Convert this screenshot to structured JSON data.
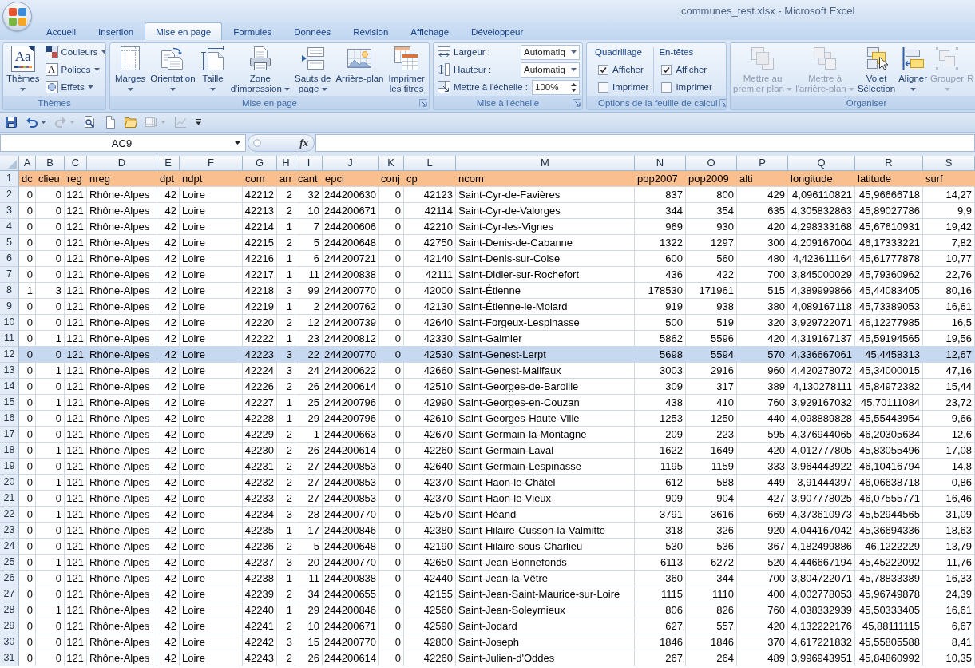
{
  "window": {
    "title": "communes_test.xlsx - Microsoft Excel"
  },
  "tabs": [
    {
      "label": "Accueil",
      "selected": false
    },
    {
      "label": "Insertion",
      "selected": false
    },
    {
      "label": "Mise en page",
      "selected": true
    },
    {
      "label": "Formules",
      "selected": false
    },
    {
      "label": "Données",
      "selected": false
    },
    {
      "label": "Révision",
      "selected": false
    },
    {
      "label": "Affichage",
      "selected": false
    },
    {
      "label": "Développeur",
      "selected": false
    }
  ],
  "ribbon": {
    "groups": [
      {
        "kind": "themes",
        "label": "Thèmes",
        "launcher": false,
        "button": {
          "label": "Thèmes",
          "glyph": "Aa",
          "menu": true
        },
        "items": [
          {
            "kind": "colors",
            "label": "Couleurs",
            "menu": true
          },
          {
            "kind": "fonts",
            "label": "Polices",
            "glyph": "A",
            "menu": true
          },
          {
            "kind": "effects",
            "label": "Effets",
            "menu": true
          }
        ]
      },
      {
        "kind": "large",
        "label": "Mise en page",
        "launcher": true,
        "buttons": [
          {
            "kind": "margins",
            "lines": [
              "Marges"
            ],
            "menu": true
          },
          {
            "kind": "orientation",
            "lines": [
              "Orientation"
            ],
            "menu": true
          },
          {
            "kind": "size",
            "lines": [
              "Taille"
            ],
            "menu": true
          },
          {
            "kind": "print_area",
            "lines": [
              "Zone",
              "d'impression"
            ],
            "menu": true
          },
          {
            "kind": "breaks",
            "lines": [
              "Sauts de",
              "page"
            ],
            "menu": true
          },
          {
            "kind": "background",
            "lines": [
              "Arrière-plan"
            ],
            "menu": false
          },
          {
            "kind": "print_titles",
            "lines": [
              "Imprimer",
              "les titres"
            ],
            "menu": false
          }
        ]
      },
      {
        "kind": "scale",
        "label": "Mise à l'échelle",
        "launcher": true,
        "fields": [
          {
            "kind": "width",
            "label": "Largeur :",
            "value": "Automatiq"
          },
          {
            "kind": "height",
            "label": "Hauteur :",
            "value": "Automatiq"
          },
          {
            "kind": "scale",
            "label": "Mettre à l'échelle :",
            "value": "100%"
          }
        ]
      },
      {
        "kind": "options",
        "label": "Options de la feuille de calcul",
        "launcher": true,
        "columns": [
          {
            "title": "Quadrillage",
            "options": [
              {
                "label": "Afficher",
                "checked": true
              },
              {
                "label": "Imprimer",
                "checked": false
              }
            ]
          },
          {
            "title": "En-têtes",
            "options": [
              {
                "label": "Afficher",
                "checked": true
              },
              {
                "label": "Imprimer",
                "checked": false
              }
            ]
          }
        ]
      },
      {
        "kind": "large",
        "label": "Organiser",
        "launcher": false,
        "buttons": [
          {
            "kind": "bring_forward",
            "lines": [
              "Mettre au",
              "premier plan"
            ],
            "menu": true,
            "disabled": true
          },
          {
            "kind": "send_backward",
            "lines": [
              "Mettre à",
              "l'arrière-plan"
            ],
            "menu": true,
            "disabled": true
          },
          {
            "kind": "selection_pane",
            "lines": [
              "Volet",
              "Sélection"
            ],
            "menu": false,
            "disabled": false
          },
          {
            "kind": "align",
            "lines": [
              "Aligner"
            ],
            "menu": true,
            "disabled": false
          },
          {
            "kind": "group",
            "lines": [
              "Grouper"
            ],
            "menu": true,
            "disabled": true
          },
          {
            "kind": "rotate",
            "lines": [
              "R"
            ],
            "menu": false,
            "disabled": true
          }
        ]
      }
    ]
  },
  "quick_access": [
    {
      "kind": "save",
      "menu": false,
      "disabled": false
    },
    {
      "kind": "undo",
      "menu": true,
      "disabled": false
    },
    {
      "kind": "redo",
      "menu": true,
      "disabled": true
    },
    {
      "kind": "print_preview",
      "menu": false,
      "disabled": false
    },
    {
      "kind": "new",
      "menu": false,
      "disabled": false
    },
    {
      "kind": "open",
      "menu": false,
      "disabled": false
    },
    {
      "kind": "sort",
      "menu": true,
      "disabled": true
    },
    {
      "kind": "chart",
      "menu": false,
      "disabled": true
    },
    {
      "kind": "customize",
      "menu": false,
      "disabled": false
    }
  ],
  "formula_bar": {
    "name_box": "AC9",
    "function_button": "fx"
  },
  "sheet": {
    "columns": [
      {
        "letter": "A",
        "kind": "number"
      },
      {
        "letter": "B",
        "kind": "number"
      },
      {
        "letter": "C",
        "kind": "number"
      },
      {
        "letter": "D",
        "kind": "text"
      },
      {
        "letter": "E",
        "kind": "number"
      },
      {
        "letter": "F",
        "kind": "text"
      },
      {
        "letter": "G",
        "kind": "number"
      },
      {
        "letter": "H",
        "kind": "number"
      },
      {
        "letter": "I",
        "kind": "number"
      },
      {
        "letter": "J",
        "kind": "number"
      },
      {
        "letter": "K",
        "kind": "number"
      },
      {
        "letter": "L",
        "kind": "number"
      },
      {
        "letter": "M",
        "kind": "text"
      },
      {
        "letter": "N",
        "kind": "number"
      },
      {
        "letter": "O",
        "kind": "number"
      },
      {
        "letter": "P",
        "kind": "number"
      },
      {
        "letter": "Q",
        "kind": "number"
      },
      {
        "letter": "R",
        "kind": "number"
      },
      {
        "letter": "S",
        "kind": "number"
      }
    ],
    "rows": [
      {
        "number": "1",
        "kind": "header",
        "selected": false,
        "cells": [
          "dc",
          "clieu",
          "reg",
          "nreg",
          "dpt",
          "ndpt",
          "com",
          "arr",
          "cant",
          "epci",
          "conj",
          "cp",
          "ncom",
          "pop2007",
          "pop2009",
          "alti",
          "longitude",
          "latitude",
          "surf"
        ]
      },
      {
        "number": "2",
        "kind": "data",
        "selected": false,
        "cells": [
          "0",
          "0",
          "121",
          "Rhône-Alpes",
          "42",
          "Loire",
          "42212",
          "2",
          "32",
          "244200630",
          "0",
          "42123",
          "Saint-Cyr-de-Favières",
          "837",
          "800",
          "429",
          "4,096110821",
          "45,96666718",
          "14,27"
        ]
      },
      {
        "number": "3",
        "kind": "data",
        "selected": false,
        "cells": [
          "0",
          "0",
          "121",
          "Rhône-Alpes",
          "42",
          "Loire",
          "42213",
          "2",
          "10",
          "244200671",
          "0",
          "42114",
          "Saint-Cyr-de-Valorges",
          "344",
          "354",
          "635",
          "4,305832863",
          "45,89027786",
          "9,9"
        ]
      },
      {
        "number": "4",
        "kind": "data",
        "selected": false,
        "cells": [
          "0",
          "0",
          "121",
          "Rhône-Alpes",
          "42",
          "Loire",
          "42214",
          "1",
          "7",
          "244200606",
          "0",
          "42210",
          "Saint-Cyr-les-Vignes",
          "969",
          "930",
          "420",
          "4,298333168",
          "45,67610931",
          "19,42"
        ]
      },
      {
        "number": "5",
        "kind": "data",
        "selected": false,
        "cells": [
          "0",
          "0",
          "121",
          "Rhône-Alpes",
          "42",
          "Loire",
          "42215",
          "2",
          "5",
          "244200648",
          "0",
          "42750",
          "Saint-Denis-de-Cabanne",
          "1322",
          "1297",
          "300",
          "4,209167004",
          "46,17333221",
          "7,82"
        ]
      },
      {
        "number": "6",
        "kind": "data",
        "selected": false,
        "cells": [
          "0",
          "0",
          "121",
          "Rhône-Alpes",
          "42",
          "Loire",
          "42216",
          "1",
          "6",
          "244200721",
          "0",
          "42140",
          "Saint-Denis-sur-Coise",
          "600",
          "560",
          "480",
          "4,423611164",
          "45,61777878",
          "10,77"
        ]
      },
      {
        "number": "7",
        "kind": "data",
        "selected": false,
        "cells": [
          "0",
          "0",
          "121",
          "Rhône-Alpes",
          "42",
          "Loire",
          "42217",
          "1",
          "11",
          "244200838",
          "0",
          "42111",
          "Saint-Didier-sur-Rochefort",
          "436",
          "422",
          "700",
          "3,845000029",
          "45,79360962",
          "22,76"
        ]
      },
      {
        "number": "8",
        "kind": "data",
        "selected": false,
        "cells": [
          "1",
          "3",
          "121",
          "Rhône-Alpes",
          "42",
          "Loire",
          "42218",
          "3",
          "99",
          "244200770",
          "0",
          "42000",
          "Saint-Étienne",
          "178530",
          "171961",
          "515",
          "4,389999866",
          "45,44083405",
          "80,16"
        ]
      },
      {
        "number": "9",
        "kind": "data",
        "selected": false,
        "cells": [
          "0",
          "0",
          "121",
          "Rhône-Alpes",
          "42",
          "Loire",
          "42219",
          "1",
          "2",
          "244200762",
          "0",
          "42130",
          "Saint-Étienne-le-Molard",
          "919",
          "938",
          "380",
          "4,089167118",
          "45,73389053",
          "16,61"
        ]
      },
      {
        "number": "10",
        "kind": "data",
        "selected": false,
        "cells": [
          "0",
          "0",
          "121",
          "Rhône-Alpes",
          "42",
          "Loire",
          "42220",
          "2",
          "12",
          "244200739",
          "0",
          "42640",
          "Saint-Forgeux-Lespinasse",
          "500",
          "519",
          "320",
          "3,929722071",
          "46,12277985",
          "16,5"
        ]
      },
      {
        "number": "11",
        "kind": "data",
        "selected": false,
        "cells": [
          "0",
          "1",
          "121",
          "Rhône-Alpes",
          "42",
          "Loire",
          "42222",
          "1",
          "23",
          "244200812",
          "0",
          "42330",
          "Saint-Galmier",
          "5862",
          "5596",
          "420",
          "4,319167137",
          "45,59194565",
          "19,56"
        ]
      },
      {
        "number": "12",
        "kind": "data",
        "selected": true,
        "cells": [
          "0",
          "0",
          "121",
          "Rhône-Alpes",
          "42",
          "Loire",
          "42223",
          "3",
          "22",
          "244200770",
          "0",
          "42530",
          "Saint-Genest-Lerpt",
          "5698",
          "5594",
          "570",
          "4,336667061",
          "45,4458313",
          "12,67"
        ]
      },
      {
        "number": "13",
        "kind": "data",
        "selected": false,
        "cells": [
          "0",
          "1",
          "121",
          "Rhône-Alpes",
          "42",
          "Loire",
          "42224",
          "3",
          "24",
          "244200622",
          "0",
          "42660",
          "Saint-Genest-Malifaux",
          "3003",
          "2916",
          "960",
          "4,420278072",
          "45,34000015",
          "47,16"
        ]
      },
      {
        "number": "14",
        "kind": "data",
        "selected": false,
        "cells": [
          "0",
          "0",
          "121",
          "Rhône-Alpes",
          "42",
          "Loire",
          "42226",
          "2",
          "26",
          "244200614",
          "0",
          "42510",
          "Saint-Georges-de-Baroille",
          "309",
          "317",
          "389",
          "4,130278111",
          "45,84972382",
          "15,44"
        ]
      },
      {
        "number": "15",
        "kind": "data",
        "selected": false,
        "cells": [
          "0",
          "1",
          "121",
          "Rhône-Alpes",
          "42",
          "Loire",
          "42227",
          "1",
          "25",
          "244200796",
          "0",
          "42990",
          "Saint-Georges-en-Couzan",
          "438",
          "410",
          "760",
          "3,929167032",
          "45,70111084",
          "23,72"
        ]
      },
      {
        "number": "16",
        "kind": "data",
        "selected": false,
        "cells": [
          "0",
          "0",
          "121",
          "Rhône-Alpes",
          "42",
          "Loire",
          "42228",
          "1",
          "29",
          "244200796",
          "0",
          "42610",
          "Saint-Georges-Haute-Ville",
          "1253",
          "1250",
          "440",
          "4,098889828",
          "45,55443954",
          "9,66"
        ]
      },
      {
        "number": "17",
        "kind": "data",
        "selected": false,
        "cells": [
          "0",
          "0",
          "121",
          "Rhône-Alpes",
          "42",
          "Loire",
          "42229",
          "2",
          "1",
          "244200663",
          "0",
          "42670",
          "Saint-Germain-la-Montagne",
          "209",
          "223",
          "595",
          "4,376944065",
          "46,20305634",
          "12,6"
        ]
      },
      {
        "number": "18",
        "kind": "data",
        "selected": false,
        "cells": [
          "0",
          "1",
          "121",
          "Rhône-Alpes",
          "42",
          "Loire",
          "42230",
          "2",
          "26",
          "244200614",
          "0",
          "42260",
          "Saint-Germain-Laval",
          "1622",
          "1649",
          "420",
          "4,012777805",
          "45,83055496",
          "17,08"
        ]
      },
      {
        "number": "19",
        "kind": "data",
        "selected": false,
        "cells": [
          "0",
          "0",
          "121",
          "Rhône-Alpes",
          "42",
          "Loire",
          "42231",
          "2",
          "27",
          "244200853",
          "0",
          "42640",
          "Saint-Germain-Lespinasse",
          "1195",
          "1159",
          "333",
          "3,964443922",
          "46,10416794",
          "14,8"
        ]
      },
      {
        "number": "20",
        "kind": "data",
        "selected": false,
        "cells": [
          "0",
          "1",
          "121",
          "Rhône-Alpes",
          "42",
          "Loire",
          "42232",
          "2",
          "27",
          "244200853",
          "0",
          "42370",
          "Saint-Haon-le-Châtel",
          "612",
          "588",
          "449",
          "3,91444397",
          "46,06638718",
          "0,86"
        ]
      },
      {
        "number": "21",
        "kind": "data",
        "selected": false,
        "cells": [
          "0",
          "0",
          "121",
          "Rhône-Alpes",
          "42",
          "Loire",
          "42233",
          "2",
          "27",
          "244200853",
          "0",
          "42370",
          "Saint-Haon-le-Vieux",
          "909",
          "904",
          "427",
          "3,907778025",
          "46,07555771",
          "16,46"
        ]
      },
      {
        "number": "22",
        "kind": "data",
        "selected": false,
        "cells": [
          "0",
          "1",
          "121",
          "Rhône-Alpes",
          "42",
          "Loire",
          "42234",
          "3",
          "28",
          "244200770",
          "0",
          "42570",
          "Saint-Héand",
          "3791",
          "3616",
          "669",
          "4,373610973",
          "45,52944565",
          "31,09"
        ]
      },
      {
        "number": "23",
        "kind": "data",
        "selected": false,
        "cells": [
          "0",
          "0",
          "121",
          "Rhône-Alpes",
          "42",
          "Loire",
          "42235",
          "1",
          "17",
          "244200846",
          "0",
          "42380",
          "Saint-Hilaire-Cusson-la-Valmitte",
          "318",
          "326",
          "920",
          "4,044167042",
          "45,36694336",
          "18,63"
        ]
      },
      {
        "number": "24",
        "kind": "data",
        "selected": false,
        "cells": [
          "0",
          "0",
          "121",
          "Rhône-Alpes",
          "42",
          "Loire",
          "42236",
          "2",
          "5",
          "244200648",
          "0",
          "42190",
          "Saint-Hilaire-sous-Charlieu",
          "530",
          "536",
          "367",
          "4,182499886",
          "46,1222229",
          "13,79"
        ]
      },
      {
        "number": "25",
        "kind": "data",
        "selected": false,
        "cells": [
          "0",
          "1",
          "121",
          "Rhône-Alpes",
          "42",
          "Loire",
          "42237",
          "3",
          "20",
          "244200770",
          "0",
          "42650",
          "Saint-Jean-Bonnefonds",
          "6113",
          "6272",
          "520",
          "4,446667194",
          "45,45222092",
          "11,76"
        ]
      },
      {
        "number": "26",
        "kind": "data",
        "selected": false,
        "cells": [
          "0",
          "0",
          "121",
          "Rhône-Alpes",
          "42",
          "Loire",
          "42238",
          "1",
          "11",
          "244200838",
          "0",
          "42440",
          "Saint-Jean-la-Vêtre",
          "360",
          "344",
          "700",
          "3,804722071",
          "45,78833389",
          "16,33"
        ]
      },
      {
        "number": "27",
        "kind": "data",
        "selected": false,
        "cells": [
          "0",
          "0",
          "121",
          "Rhône-Alpes",
          "42",
          "Loire",
          "42239",
          "2",
          "34",
          "244200655",
          "0",
          "42155",
          "Saint-Jean-Saint-Maurice-sur-Loire",
          "1115",
          "1110",
          "400",
          "4,002778053",
          "45,96749878",
          "24,39"
        ]
      },
      {
        "number": "28",
        "kind": "data",
        "selected": false,
        "cells": [
          "0",
          "1",
          "121",
          "Rhône-Alpes",
          "42",
          "Loire",
          "42240",
          "1",
          "29",
          "244200846",
          "0",
          "42560",
          "Saint-Jean-Soleymieux",
          "806",
          "826",
          "760",
          "4,038332939",
          "45,50333405",
          "16,61"
        ]
      },
      {
        "number": "29",
        "kind": "data",
        "selected": false,
        "cells": [
          "0",
          "0",
          "121",
          "Rhône-Alpes",
          "42",
          "Loire",
          "42241",
          "2",
          "10",
          "244200671",
          "0",
          "42590",
          "Saint-Jodard",
          "627",
          "557",
          "420",
          "4,132222176",
          "45,88111115",
          "6,67"
        ]
      },
      {
        "number": "30",
        "kind": "data",
        "selected": false,
        "cells": [
          "0",
          "0",
          "121",
          "Rhône-Alpes",
          "42",
          "Loire",
          "42242",
          "3",
          "15",
          "244200770",
          "0",
          "42800",
          "Saint-Joseph",
          "1846",
          "1846",
          "370",
          "4,617221832",
          "45,55805588",
          "8,41"
        ]
      },
      {
        "number": "31",
        "kind": "data",
        "selected": false,
        "cells": [
          "0",
          "0",
          "121",
          "Rhône-Alpes",
          "42",
          "Loire",
          "42243",
          "2",
          "26",
          "244200614",
          "0",
          "42260",
          "Saint-Julien-d'Oddes",
          "267",
          "264",
          "489",
          "3,996943951",
          "45,84860992",
          "10,35"
        ]
      }
    ]
  }
}
